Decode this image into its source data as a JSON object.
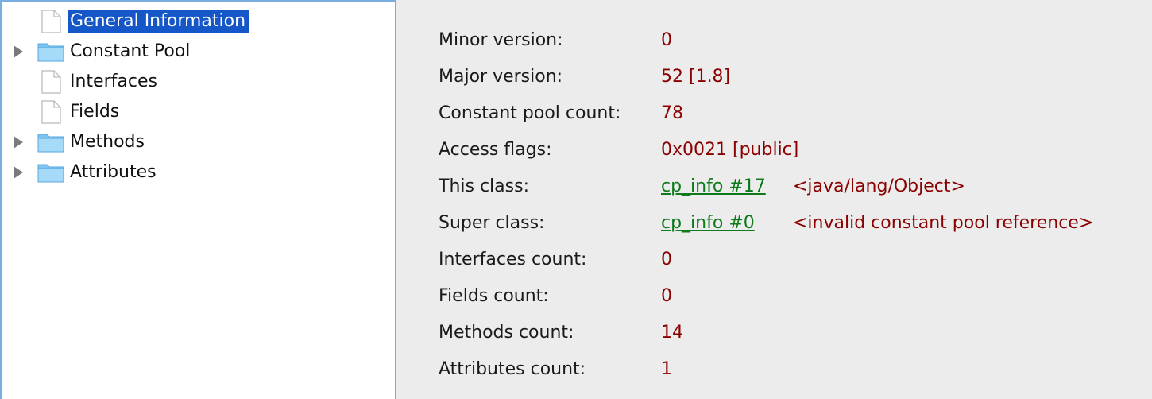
{
  "tree": {
    "items": [
      {
        "label": "General Information",
        "icon": "document-icon",
        "expandable": false,
        "selected": true
      },
      {
        "label": "Constant Pool",
        "icon": "folder-icon",
        "expandable": true,
        "selected": false
      },
      {
        "label": "Interfaces",
        "icon": "document-icon",
        "expandable": false,
        "selected": false
      },
      {
        "label": "Fields",
        "icon": "document-icon",
        "expandable": false,
        "selected": false
      },
      {
        "label": "Methods",
        "icon": "folder-icon",
        "expandable": true,
        "selected": false
      },
      {
        "label": "Attributes",
        "icon": "folder-icon",
        "expandable": true,
        "selected": false
      }
    ]
  },
  "info": {
    "minor_version": {
      "label": "Minor version:",
      "value": "0"
    },
    "major_version": {
      "label": "Major version:",
      "value": "52 [1.8]"
    },
    "constant_pool_count": {
      "label": "Constant pool count:",
      "value": "78"
    },
    "access_flags": {
      "label": "Access flags:",
      "value": "0x0021 [public]"
    },
    "this_class": {
      "label": "This class:",
      "link": "cp_info #17",
      "desc": "<java/lang/Object>"
    },
    "super_class": {
      "label": "Super class:",
      "link": "cp_info #0",
      "desc": "<invalid constant pool reference>"
    },
    "interfaces_count": {
      "label": "Interfaces count:",
      "value": "0"
    },
    "fields_count": {
      "label": "Fields count:",
      "value": "0"
    },
    "methods_count": {
      "label": "Methods count:",
      "value": "14"
    },
    "attributes_count": {
      "label": "Attributes count:",
      "value": "1"
    }
  },
  "colors": {
    "selection": "#1556c8",
    "value_text": "#8b0000",
    "link_text": "#0f7a1c",
    "panel_border": "#7aaee3",
    "background": "#ececec"
  }
}
